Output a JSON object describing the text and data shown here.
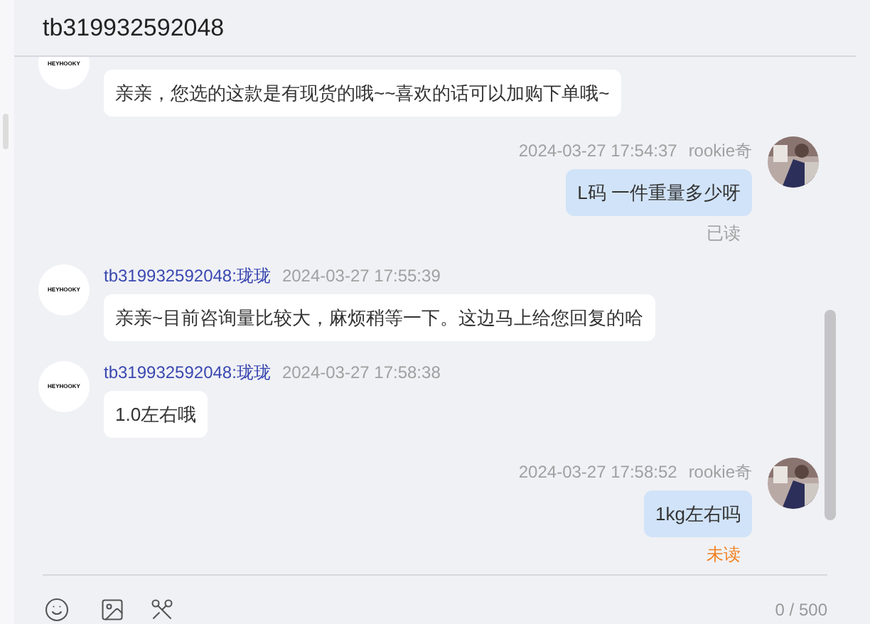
{
  "header": {
    "title": "tb319932592048"
  },
  "messages": [
    {
      "kind": "other",
      "avatar_logo": "HEYHOOKY",
      "text": "亲亲，您选的这款是有现货的哦~~喜欢的话可以加购下单哦~"
    },
    {
      "kind": "me",
      "time": "2024-03-27 17:54:37",
      "sender": "rookie奇",
      "text": "L码 一件重量多少呀",
      "status": "已读",
      "read": true
    },
    {
      "kind": "other",
      "avatar_logo": "HEYHOOKY",
      "sender": "tb319932592048:珑珑",
      "time": "2024-03-27 17:55:39",
      "text": "亲亲~目前咨询量比较大，麻烦稍等一下。这边马上给您回复的哈"
    },
    {
      "kind": "other",
      "avatar_logo": "HEYHOOKY",
      "sender": "tb319932592048:珑珑",
      "time": "2024-03-27 17:58:38",
      "text": "1.0左右哦"
    },
    {
      "kind": "me",
      "time": "2024-03-27 17:58:52",
      "sender": "rookie奇",
      "text": "1kg左右吗",
      "status": "未读",
      "read": false
    }
  ],
  "composer": {
    "counter": "0 / 500"
  }
}
